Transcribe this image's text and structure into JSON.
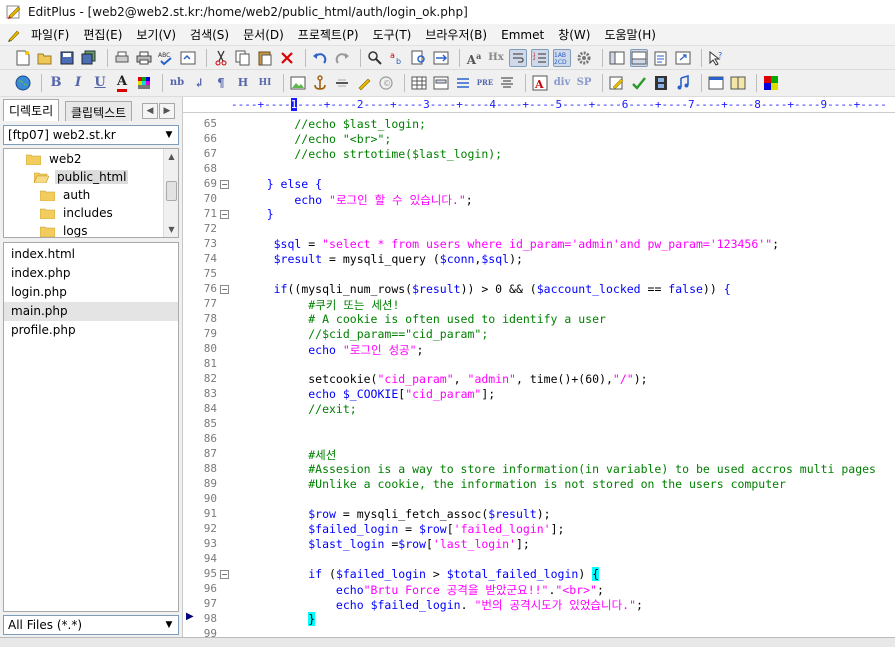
{
  "window": {
    "title": "EditPlus - [web2@web2.st.kr:/home/web2/public_html/auth/login_ok.php]"
  },
  "menu": [
    {
      "id": "file",
      "label": "파일(F)"
    },
    {
      "id": "edit",
      "label": "편집(E)"
    },
    {
      "id": "view",
      "label": "보기(V)"
    },
    {
      "id": "search",
      "label": "검색(S)"
    },
    {
      "id": "document",
      "label": "문서(D)"
    },
    {
      "id": "project",
      "label": "프로젝트(P)"
    },
    {
      "id": "tools",
      "label": "도구(T)"
    },
    {
      "id": "browser",
      "label": "브라우저(B)"
    },
    {
      "id": "emmet",
      "label": "Emmet"
    },
    {
      "id": "window",
      "label": "창(W)"
    },
    {
      "id": "help",
      "label": "도움말(H)"
    }
  ],
  "toolbar2_text": {
    "bold": "B",
    "italic": "I",
    "underline": "U",
    "color": "A",
    "nbsp": "nb",
    "br": "↲",
    "para": "¶",
    "heading": "H",
    "div": "div",
    "span": "SP",
    "pre": "PRE",
    "hx": "Hx"
  },
  "sidebar": {
    "tabs": [
      {
        "id": "directory",
        "label": "디렉토리"
      },
      {
        "id": "cliptext",
        "label": "클립텍스트"
      }
    ],
    "ftp_account": "[ftp07] web2.st.kr",
    "tree": [
      {
        "label": "web2",
        "depth": 0
      },
      {
        "label": "public_html",
        "depth": 1,
        "selected": true
      },
      {
        "label": "auth",
        "depth": 2
      },
      {
        "label": "includes",
        "depth": 2
      },
      {
        "label": "logs",
        "depth": 2
      }
    ],
    "files": [
      {
        "name": "index.html"
      },
      {
        "name": "index.php"
      },
      {
        "name": "login.php"
      },
      {
        "name": "main.php",
        "selected": true
      },
      {
        "name": "profile.php"
      }
    ],
    "file_filter": "All Files (*.*)"
  },
  "ruler": {
    "marks": [
      "1",
      "2",
      "3",
      "4",
      "5",
      "6",
      "7",
      "8",
      "9"
    ],
    "current_column": "1"
  },
  "code": {
    "lines": [
      {
        "n": "65",
        "segs": [
          [
            "c-com",
            "        //echo $last_login;"
          ]
        ]
      },
      {
        "n": "66",
        "segs": [
          [
            "c-com",
            "        //echo \"<br>\";"
          ]
        ]
      },
      {
        "n": "67",
        "segs": [
          [
            "c-com",
            "        //echo strtotime($last_login);"
          ]
        ]
      },
      {
        "n": "68",
        "segs": []
      },
      {
        "n": "69",
        "fold": true,
        "segs": [
          [
            "c-kw",
            "    } else {"
          ]
        ]
      },
      {
        "n": "70",
        "segs": [
          [
            "c-kw",
            "        echo "
          ],
          [
            "c-str",
            "\"로그인 할 수 있습니다.\""
          ],
          [
            "c-fn",
            ";"
          ]
        ]
      },
      {
        "n": "71",
        "fold": true,
        "segs": [
          [
            "c-kw",
            "    }"
          ]
        ]
      },
      {
        "n": "72",
        "segs": []
      },
      {
        "n": "73",
        "segs": [
          [
            "c-var",
            "     $sql"
          ],
          [
            "c-fn",
            " = "
          ],
          [
            "c-str",
            "\"select * from users where id_param='admin'and pw_param='123456'\""
          ],
          [
            "c-fn",
            ";"
          ]
        ]
      },
      {
        "n": "74",
        "segs": [
          [
            "c-var",
            "     $result"
          ],
          [
            "c-fn",
            " = mysqli_query ("
          ],
          [
            "c-var",
            "$conn"
          ],
          [
            "c-fn",
            ","
          ],
          [
            "c-var",
            "$sql"
          ],
          [
            "c-fn",
            ");"
          ]
        ]
      },
      {
        "n": "75",
        "segs": []
      },
      {
        "n": "76",
        "fold": true,
        "segs": [
          [
            "c-kw",
            "     if"
          ],
          [
            "c-fn",
            "((mysqli_num_rows("
          ],
          [
            "c-var",
            "$result"
          ],
          [
            "c-fn",
            ")) > 0 && ("
          ],
          [
            "c-var",
            "$account_locked"
          ],
          [
            "c-fn",
            " == "
          ],
          [
            "c-kw",
            "false"
          ],
          [
            "c-fn",
            ")) "
          ],
          [
            "c-kw",
            "{"
          ]
        ]
      },
      {
        "n": "77",
        "segs": [
          [
            "c-com",
            "          #쿠키 또는 세션!"
          ]
        ]
      },
      {
        "n": "78",
        "segs": [
          [
            "c-com",
            "          # A cookie is often used to identify a user"
          ]
        ]
      },
      {
        "n": "79",
        "segs": [
          [
            "c-com",
            "          //$cid_param==\"cid_param\";"
          ]
        ]
      },
      {
        "n": "80",
        "segs": [
          [
            "c-kw",
            "          echo "
          ],
          [
            "c-str",
            "\"로그인 성공\""
          ],
          [
            "c-fn",
            ";"
          ]
        ]
      },
      {
        "n": "81",
        "segs": []
      },
      {
        "n": "82",
        "segs": [
          [
            "c-fn",
            "          setcookie("
          ],
          [
            "c-str",
            "\"cid_param\""
          ],
          [
            "c-fn",
            ", "
          ],
          [
            "c-str",
            "\"admin\""
          ],
          [
            "c-fn",
            ", time()+(60),"
          ],
          [
            "c-str",
            "\"/\""
          ],
          [
            "c-fn",
            ");"
          ]
        ]
      },
      {
        "n": "83",
        "segs": [
          [
            "c-kw",
            "          echo "
          ],
          [
            "c-var",
            "$_COOKIE"
          ],
          [
            "c-fn",
            "["
          ],
          [
            "c-str",
            "\"cid_param\""
          ],
          [
            "c-fn",
            "];"
          ]
        ]
      },
      {
        "n": "84",
        "segs": [
          [
            "c-com",
            "          //exit;"
          ]
        ]
      },
      {
        "n": "85",
        "segs": []
      },
      {
        "n": "86",
        "segs": []
      },
      {
        "n": "87",
        "segs": [
          [
            "c-com",
            "          #세션"
          ]
        ]
      },
      {
        "n": "88",
        "segs": [
          [
            "c-com",
            "          #Assesion is a way to store information(in variable) to be used accros multi pages"
          ]
        ]
      },
      {
        "n": "89",
        "segs": [
          [
            "c-com",
            "          #Unlike a cookie, the information is not stored on the users computer"
          ]
        ]
      },
      {
        "n": "90",
        "segs": []
      },
      {
        "n": "91",
        "segs": [
          [
            "c-var",
            "          $row"
          ],
          [
            "c-fn",
            " = mysqli_fetch_assoc("
          ],
          [
            "c-var",
            "$result"
          ],
          [
            "c-fn",
            ");"
          ]
        ]
      },
      {
        "n": "92",
        "segs": [
          [
            "c-var",
            "          $failed_login"
          ],
          [
            "c-fn",
            " = "
          ],
          [
            "c-var",
            "$row"
          ],
          [
            "c-fn",
            "["
          ],
          [
            "c-str",
            "'failed_login'"
          ],
          [
            "c-fn",
            "];"
          ]
        ]
      },
      {
        "n": "93",
        "segs": [
          [
            "c-var",
            "          $last_login"
          ],
          [
            "c-fn",
            " ="
          ],
          [
            "c-var",
            "$row"
          ],
          [
            "c-fn",
            "["
          ],
          [
            "c-str",
            "'last_login'"
          ],
          [
            "c-fn",
            "];"
          ]
        ]
      },
      {
        "n": "94",
        "segs": []
      },
      {
        "n": "95",
        "fold": true,
        "segs": [
          [
            "c-kw",
            "          if"
          ],
          [
            "c-fn",
            " ("
          ],
          [
            "c-var",
            "$failed_login"
          ],
          [
            "c-fn",
            " > "
          ],
          [
            "c-var",
            "$total_failed_login"
          ],
          [
            "c-fn",
            ") "
          ],
          [
            "c-brace-hl",
            "{"
          ]
        ]
      },
      {
        "n": "96",
        "segs": [
          [
            "c-kw",
            "              echo"
          ],
          [
            "c-str",
            "\"Brtu Force 공격을 받았군요!!\""
          ],
          [
            "c-fn",
            "."
          ],
          [
            "c-str",
            "\"<br>\""
          ],
          [
            "c-fn",
            ";"
          ]
        ]
      },
      {
        "n": "97",
        "segs": [
          [
            "c-kw",
            "              echo "
          ],
          [
            "c-var",
            "$failed_login"
          ],
          [
            "c-fn",
            ". "
          ],
          [
            "c-str",
            "\"번의 공격시도가 있었습니다.\""
          ],
          [
            "c-fn",
            ";"
          ]
        ]
      },
      {
        "n": "98",
        "segs": [
          [
            "c-fn",
            "          "
          ],
          [
            "c-brace-hl",
            "}"
          ]
        ]
      },
      {
        "n": "99",
        "segs": []
      }
    ]
  }
}
